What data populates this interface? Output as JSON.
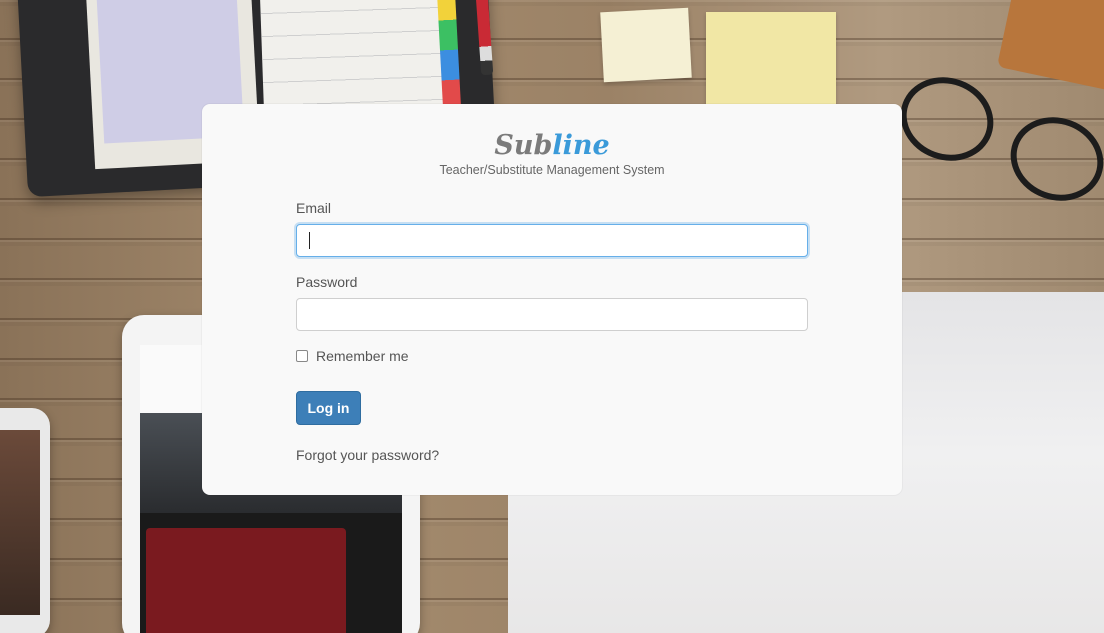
{
  "brand": {
    "logo_part1": "Sub",
    "logo_part2": "line",
    "subtitle": "Teacher/Substitute Management System",
    "colors": {
      "logo_gray": "#7b7b7b",
      "logo_blue": "#3a9ad9"
    }
  },
  "form": {
    "email_label": "Email",
    "email_value": "",
    "password_label": "Password",
    "password_value": "",
    "remember_label": "Remember me",
    "remember_checked": false,
    "submit_label": "Log in",
    "forgot_label": "Forgot your password?"
  },
  "colors": {
    "button": "#3d7fb8",
    "focus_ring": "#66afe9",
    "card_background": "#f9f9f9"
  }
}
